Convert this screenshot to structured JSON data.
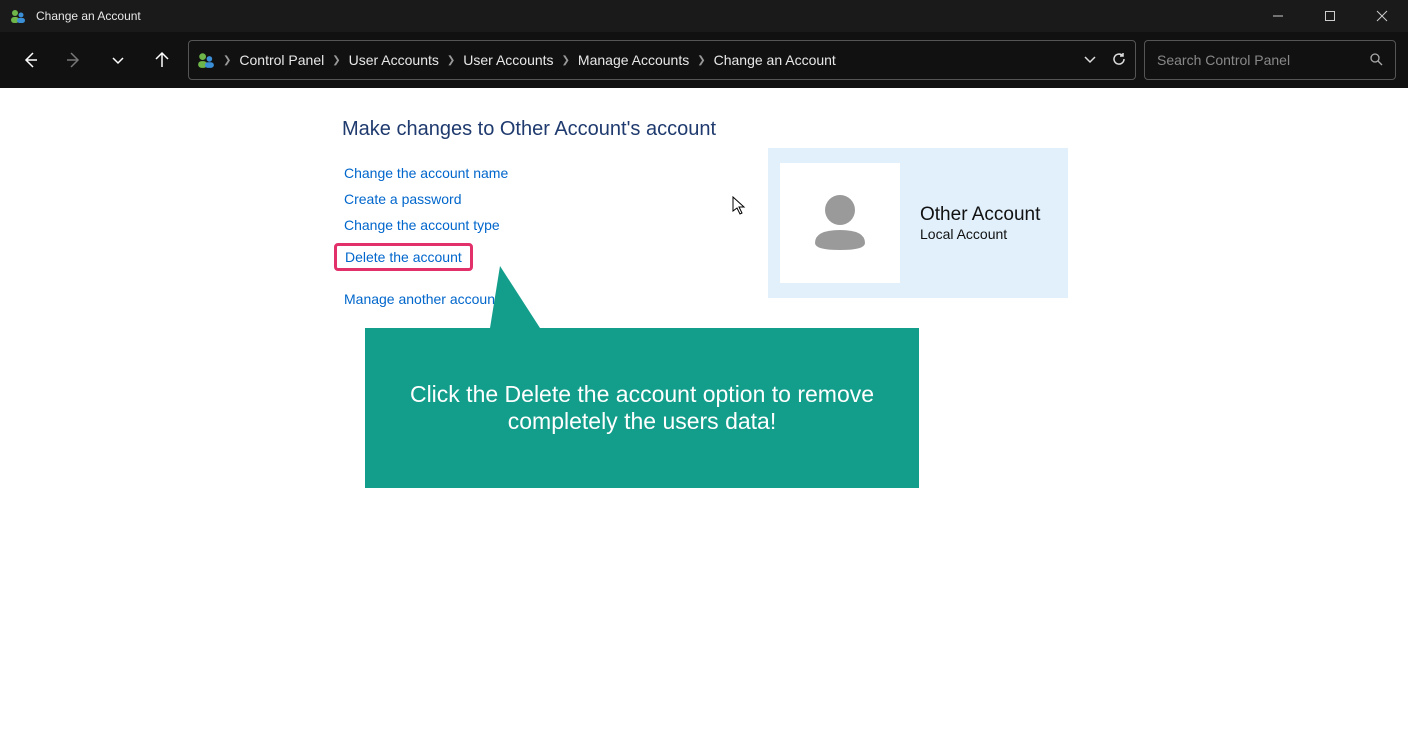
{
  "window": {
    "title": "Change an Account"
  },
  "breadcrumb": {
    "items": [
      "Control Panel",
      "User Accounts",
      "User Accounts",
      "Manage Accounts",
      "Change an Account"
    ]
  },
  "search": {
    "placeholder": "Search Control Panel"
  },
  "page": {
    "heading": "Make changes to Other Account's account",
    "links": {
      "change_name": "Change the account name",
      "create_password": "Create a password",
      "change_type": "Change the account type",
      "delete_account": "Delete the account",
      "manage_another": "Manage another account"
    }
  },
  "account_card": {
    "name": "Other Account",
    "type": "Local Account"
  },
  "callout": {
    "text": "Click the Delete the account option to remove completely the users data!"
  }
}
